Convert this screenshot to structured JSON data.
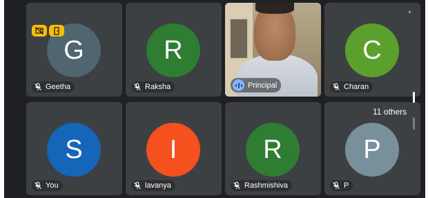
{
  "participants": [
    {
      "name": "Geetha",
      "initial": "G",
      "color": "#4f6670",
      "muted": true
    },
    {
      "name": "Raksha",
      "initial": "R",
      "color": "#2e7d32",
      "muted": true
    },
    {
      "name": "Principal",
      "initial": "",
      "color": "",
      "muted": false,
      "video": true,
      "speaking": true
    },
    {
      "name": "Charan",
      "initial": "C",
      "color": "#5ba02d",
      "muted": true
    },
    {
      "name": "You",
      "initial": "S",
      "color": "#1565b8",
      "muted": true
    },
    {
      "name": "lavanya",
      "initial": "I",
      "color": "#f4511e",
      "muted": true
    },
    {
      "name": "Rashmishiva",
      "initial": "R",
      "color": "#2e7d32",
      "muted": true
    },
    {
      "name": "P",
      "initial": "P",
      "color": "#78909c",
      "muted": true
    }
  ],
  "overflow": {
    "label": "11 others"
  },
  "colors": {
    "background": "#202124",
    "tile": "#3c4043",
    "badge": "#fbbc04",
    "active_border": "#8ab4f8"
  },
  "icons": {
    "muted": "mic-off-icon",
    "speaking": "audio-wave-icon",
    "badge_1": "video-off-icon",
    "badge_2": "door-icon"
  }
}
